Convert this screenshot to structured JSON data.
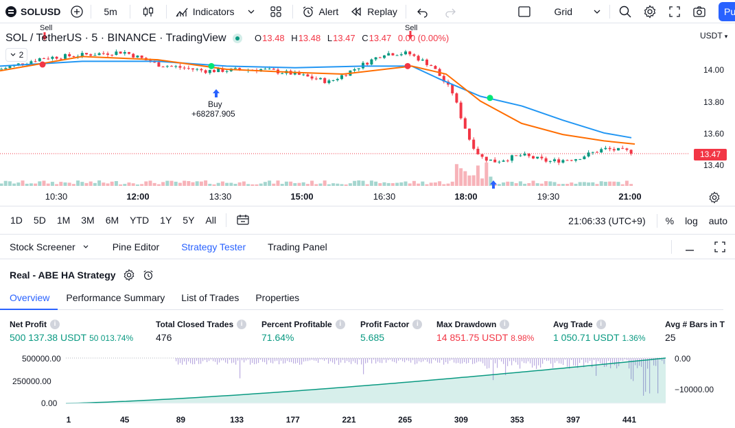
{
  "toolbar": {
    "symbol": "SOLUSD",
    "interval": "5m",
    "indicators_label": "Indicators",
    "alert_label": "Alert",
    "replay_label": "Replay",
    "layout_label": "Grid",
    "publish_label": "Pu"
  },
  "chart": {
    "title": "SOL / TetherUS · 5 · BINANCE · TradingView",
    "ohlc": {
      "o_key": "O",
      "o": "13.48",
      "h_key": "H",
      "h": "13.48",
      "l_key": "L",
      "l": "13.47",
      "c_key": "C",
      "c": "13.47",
      "change": "0.00 (0.00%)"
    },
    "collapse_count": "2",
    "currency": "USDT",
    "price_ticks": [
      "14.00",
      "13.80",
      "13.60",
      "13.40"
    ],
    "last_price": "13.47",
    "time_ticks": [
      {
        "label": "10:30",
        "bold": false
      },
      {
        "label": "12:00",
        "bold": true
      },
      {
        "label": "13:30",
        "bold": false
      },
      {
        "label": "15:00",
        "bold": true
      },
      {
        "label": "16:30",
        "bold": false
      },
      {
        "label": "18:00",
        "bold": true
      },
      {
        "label": "19:30",
        "bold": false
      },
      {
        "label": "21:00",
        "bold": true
      }
    ],
    "sell_label_1": "Sell",
    "sell_label_2": "Sell",
    "buy_label": "Buy",
    "buy_profit": "+68287.905",
    "colors": {
      "up": "#089981",
      "down": "#f23645",
      "ma_fast": "#ff6d00",
      "ma_slow": "#2196f3",
      "vol_up": "#a5d6cf",
      "vol_down": "#f7b3b9"
    }
  },
  "rangebar": {
    "ranges": [
      "1D",
      "5D",
      "1M",
      "3M",
      "6M",
      "YTD",
      "1Y",
      "5Y",
      "All"
    ],
    "clock": "21:06:33 (UTC+9)",
    "percent_label": "%",
    "log_label": "log",
    "auto_label": "auto"
  },
  "panel_tabs": [
    {
      "label": "Stock Screener",
      "has_chevron": true
    },
    {
      "label": "Pine Editor"
    },
    {
      "label": "Strategy Tester",
      "active": true
    },
    {
      "label": "Trading Panel"
    }
  ],
  "strategy": {
    "name": "Real - ABE HA Strategy",
    "subtabs": [
      "Overview",
      "Performance Summary",
      "List of Trades",
      "Properties"
    ],
    "metrics": [
      {
        "label": "Net Profit",
        "value": "500 137.38 USDT",
        "pct": "50 013.74%",
        "color": "green"
      },
      {
        "label": "Total Closed Trades",
        "value": "476",
        "pct": "",
        "color": "dark"
      },
      {
        "label": "Percent Profitable",
        "value": "71.64%",
        "pct": "",
        "color": "green"
      },
      {
        "label": "Profit Factor",
        "value": "5.685",
        "pct": "",
        "color": "green"
      },
      {
        "label": "Max Drawdown",
        "value": "14 851.75 USDT",
        "pct": "8.98%",
        "color": "red"
      },
      {
        "label": "Avg Trade",
        "value": "1 050.71 USDT",
        "pct": "1.36%",
        "color": "green"
      },
      {
        "label": "Avg # Bars in T",
        "value": "25",
        "pct": "",
        "color": "dark"
      }
    ],
    "equity": {
      "left_ticks": [
        "500000.00",
        "250000.00",
        "0.00"
      ],
      "right_ticks": [
        "0.00",
        "−10000.00"
      ],
      "x_ticks": [
        "1",
        "45",
        "89",
        "133",
        "177",
        "221",
        "265",
        "309",
        "353",
        "397",
        "441"
      ],
      "equity_color": "#089981",
      "drawdown_color": "#9c88d4"
    }
  }
}
